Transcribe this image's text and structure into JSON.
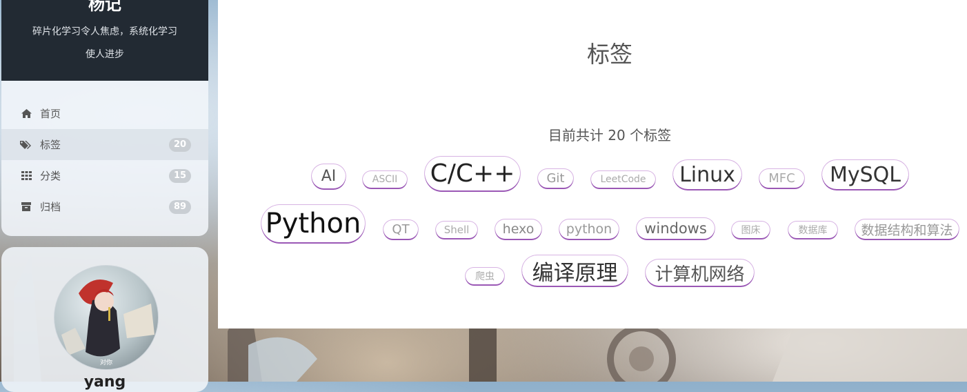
{
  "sidebar": {
    "brand_title": "杨记",
    "brand_subtitle_line1": "碎片化学习令人焦虑，系统化学习",
    "brand_subtitle_line2": "使人进步",
    "menu": [
      {
        "label": "首页",
        "icon": "home-icon",
        "badge": null
      },
      {
        "label": "标签",
        "icon": "tags-icon",
        "badge": "20"
      },
      {
        "label": "分类",
        "icon": "grid-icon",
        "badge": "15"
      },
      {
        "label": "归档",
        "icon": "archive-icon",
        "badge": "89"
      }
    ],
    "avatar_caption": "对你",
    "author_name": "yang"
  },
  "main": {
    "title": "标签",
    "tag_count_text": "目前共计 20 个标签",
    "tags": [
      {
        "label": "AI",
        "color": "#555555"
      },
      {
        "label": "ASCII",
        "color": "#aaaaaa"
      },
      {
        "label": "C/C++",
        "color": "#222222"
      },
      {
        "label": "Git",
        "color": "#999999"
      },
      {
        "label": "LeetCode",
        "color": "#aaaaaa"
      },
      {
        "label": "Linux",
        "color": "#333333"
      },
      {
        "label": "MFC",
        "color": "#aaaaaa"
      },
      {
        "label": "MySQL",
        "color": "#333333"
      },
      {
        "label": "Python",
        "color": "#111111"
      },
      {
        "label": "QT",
        "color": "#999999"
      },
      {
        "label": "Shell",
        "color": "#aaaaaa"
      },
      {
        "label": "hexo",
        "color": "#888888"
      },
      {
        "label": "python",
        "color": "#999999"
      },
      {
        "label": "windows",
        "color": "#666666"
      },
      {
        "label": "图床",
        "color": "#aaaaaa"
      },
      {
        "label": "数据库",
        "color": "#aaaaaa"
      },
      {
        "label": "数据结构和算法",
        "color": "#999999"
      },
      {
        "label": "爬虫",
        "color": "#aaaaaa"
      },
      {
        "label": "编译原理",
        "color": "#333333"
      },
      {
        "label": "计算机网络",
        "color": "#555555"
      }
    ]
  },
  "colors": {
    "brand_bg": "#222a33",
    "tag_underline": "#9a57b5",
    "badge_bg": "#c9ced3"
  }
}
